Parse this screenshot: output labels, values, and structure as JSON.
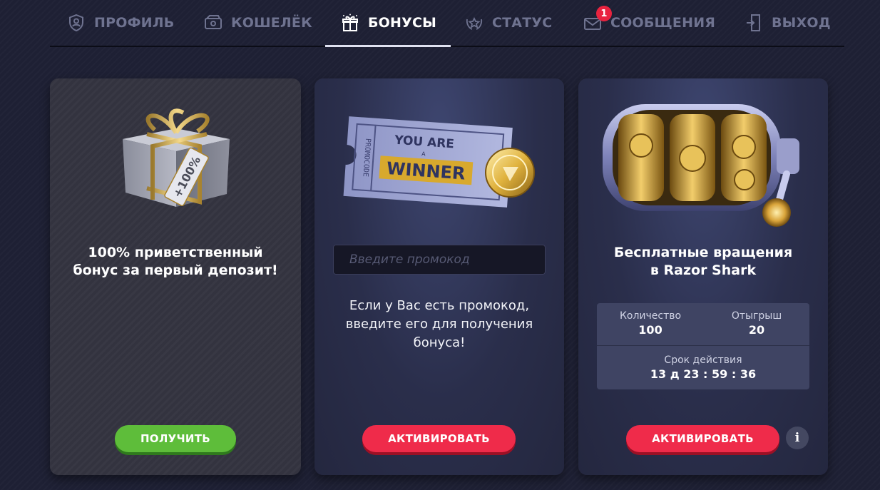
{
  "nav": {
    "items": [
      {
        "label": "ПРОФИЛЬ",
        "icon": "shield-user-icon"
      },
      {
        "label": "КОШЕЛЁК",
        "icon": "wallet-icon"
      },
      {
        "label": "БОНУСЫ",
        "icon": "gift-icon",
        "active": true
      },
      {
        "label": "СТАТУС",
        "icon": "status-wreath-icon"
      },
      {
        "label": "СООБЩЕНИЯ",
        "icon": "envelope-icon",
        "badge": "1"
      },
      {
        "label": "ВЫХОД",
        "icon": "exit-door-icon"
      }
    ]
  },
  "cards": {
    "welcome": {
      "title_line1": "100% приветственный",
      "title_line2": "бонус за первый депозит!",
      "image_label": "+100%",
      "button": "ПОЛУЧИТЬ"
    },
    "promo": {
      "ticket_text_top": "YOU ARE",
      "ticket_text_mid": "A",
      "ticket_text_main": "WINNER",
      "ticket_side": "PROMOCODE",
      "input_placeholder": "Введите промокод",
      "desc_line1": "Если у Вас есть промокод,",
      "desc_line2": "введите его для получения",
      "desc_line3": "бонуса!",
      "button": "АКТИВИРОВАТЬ"
    },
    "freespins": {
      "title_line1": "Бесплатные вращения",
      "title_line2": "в Razor Shark",
      "quantity_label": "Количество",
      "quantity_value": "100",
      "wager_label": "Отыгрыш",
      "wager_value": "20",
      "validity_label": "Срок действия",
      "validity_value": "13 д 23 : 59 : 36",
      "button": "АКТИВИРОВАТЬ",
      "info_button": "i"
    }
  },
  "colors": {
    "background": "#1e2034",
    "accent_red": "#ef2b4a",
    "accent_green": "#5ebd3a",
    "badge_red": "#e9233f",
    "nav_inactive": "#6f7390"
  }
}
